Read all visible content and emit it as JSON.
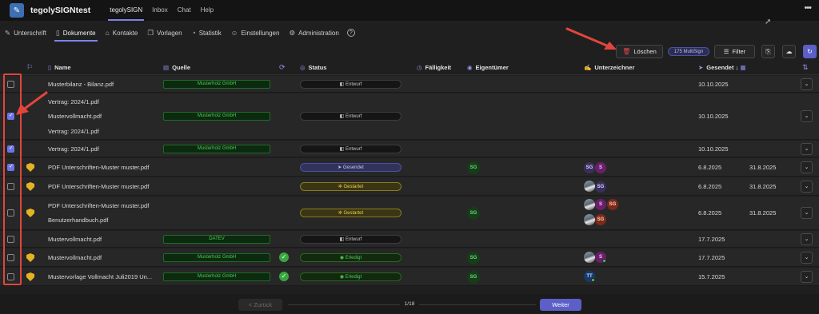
{
  "app": {
    "title": "tegolySIGNtest",
    "logo": "app-logo-icon",
    "more": "•••"
  },
  "top_nav": [
    "tegolySIGN",
    "Inbox",
    "Chat",
    "Help"
  ],
  "sub_nav": [
    {
      "label": "Unterschrift",
      "icon": "pen-icon"
    },
    {
      "label": "Dokumente",
      "icon": "document-icon"
    },
    {
      "label": "Kontakte",
      "icon": "contacts-icon"
    },
    {
      "label": "Vorlagen",
      "icon": "templates-icon"
    },
    {
      "label": "Statistik",
      "icon": "statistics-icon"
    },
    {
      "label": "Einstellungen",
      "icon": "user-settings-icon"
    },
    {
      "label": "Administration",
      "icon": "gear-icon"
    }
  ],
  "toolbar": {
    "delete_label": "Löschen",
    "multisign_badge": "175 MultiSign",
    "filter_label": "Filter"
  },
  "table": {
    "headers": {
      "name": "Name",
      "source": "Quelle",
      "status": "Status",
      "due": "Fälligkeit",
      "owner": "Eigentümer",
      "signers": "Unterzeichner",
      "sent": "Gesendet",
      "sort": "↓"
    },
    "rows": [
      {
        "names": [
          "Musterbilanz - Bilanz.pdf"
        ],
        "source": "Musterholz GmbH",
        "status": "Entwurf",
        "sent": "10.10.2025",
        "due": ""
      },
      {
        "names": [
          "Vertrag: 2024/1.pdf",
          "Mustervollmacht.pdf",
          "Vertrag: 2024/1.pdf"
        ],
        "source": "Musterholz GmbH",
        "status": "Entwurf",
        "sent": "10.10.2025",
        "due": ""
      },
      {
        "names": [
          "Vertrag: 2024/1.pdf"
        ],
        "source": "Musterholz GmbH",
        "status": "Entwurf",
        "sent": "10.10.2025",
        "due": ""
      },
      {
        "names": [
          "PDF Unterschriften-Muster muster.pdf"
        ],
        "source": "",
        "status": "Gesendet",
        "owner": "SG",
        "signers": [
          "SG",
          "S"
        ],
        "sent": "6.8.2025",
        "due": "31.8.2025"
      },
      {
        "names": [
          "PDF Unterschriften-Muster muster.pdf"
        ],
        "source": "",
        "status": "Gestartet",
        "signers": [
          "SG"
        ],
        "sent": "6.8.2025",
        "due": "31.8.2025"
      },
      {
        "names": [
          "PDF Unterschriften-Muster muster.pdf",
          "Benutzerhandbuch.pdf"
        ],
        "source": "",
        "status": "Gestartet",
        "owner": "SG",
        "signers": [
          "S",
          "SG",
          "SG"
        ],
        "sent": "6.8.2025",
        "due": "31.8.2025"
      },
      {
        "names": [
          "Mustervollmacht.pdf"
        ],
        "source": "DATEV",
        "status": "Entwurf",
        "sent": "17.7.2025",
        "due": ""
      },
      {
        "names": [
          "Mustervollmacht.pdf"
        ],
        "source": "Musterholz GmbH",
        "status": "Erledigt",
        "owner": "SG",
        "signers": [
          "S"
        ],
        "sent": "17.7.2025",
        "due": ""
      },
      {
        "names": [
          "Mustervorlage Vollmacht Juli2019 Un..."
        ],
        "source": "Musterholz GmbH",
        "status": "Erledigt",
        "owner": "SG",
        "signers": [
          "TT"
        ],
        "sent": "15.7.2025",
        "due": ""
      }
    ]
  },
  "pagination": {
    "prev": "< Zurück",
    "page": "1/18",
    "next": "Weiter"
  },
  "colors": {
    "accent": "#5b5fc7",
    "annotation": "#e2453c",
    "source_green": "#52c85a",
    "status_started": "#f0d448"
  }
}
